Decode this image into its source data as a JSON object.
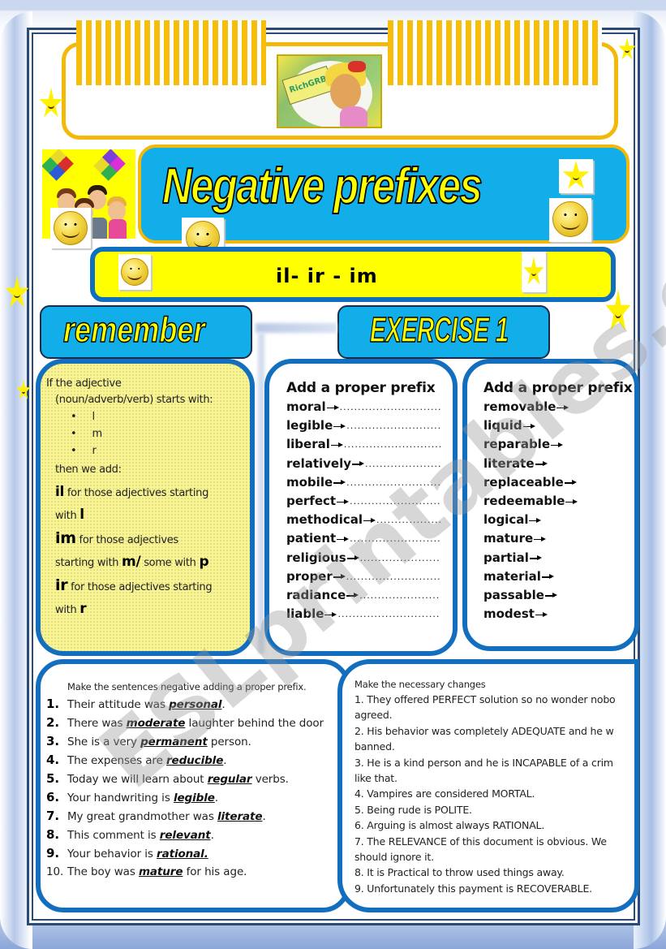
{
  "header": {
    "logo_sign_text": "RichGRB",
    "title": "Negative prefixes",
    "prefixes": "il- ir - im"
  },
  "sections": {
    "remember_label": "remember",
    "exercise_label": "EXERCISE 1"
  },
  "remember": {
    "intro_line1": "If the adjective",
    "intro_line2": "(noun/adverb/verb) starts with:",
    "letters": [
      "l",
      "m",
      "r"
    ],
    "then_line": "then we add:",
    "rules": [
      {
        "prefix": "il",
        "text": " for those adjectives starting",
        "cont": "with ",
        "letter": "l"
      },
      {
        "prefix": "im",
        "text": " for those adjectives",
        "cont": "starting with ",
        "letter": "m/",
        "extra": " some with ",
        "extra_letter": "p"
      },
      {
        "prefix": "ir",
        "text": " for those adjectives starting",
        "cont": "with ",
        "letter": "r"
      }
    ]
  },
  "exercise1": {
    "list_a": {
      "title": "Add a proper prefix",
      "words": [
        "moral",
        "legible",
        "liberal",
        "relatively",
        "mobile",
        "perfect",
        "methodical",
        "patient",
        "religious",
        "proper",
        "radiance",
        "liable"
      ],
      "dots": ".........................................."
    },
    "list_b": {
      "title": "Add a proper prefix",
      "words": [
        "removable",
        "liquid",
        "reparable",
        "literate",
        "replaceable",
        "redeemable",
        "logical",
        "mature",
        "partial",
        "material",
        "passable",
        "modest"
      ]
    }
  },
  "sentences": {
    "intro": "Make the sentences negative adding a proper prefix.",
    "items": [
      {
        "num": "1.",
        "before": "Their attitude was ",
        "word": "personal",
        "after": "."
      },
      {
        "num": "2.",
        "before": "There was ",
        "word": "moderate",
        "after": " laughter behind the door"
      },
      {
        "num": "3.",
        "before": "She is a very ",
        "word": "permanent",
        "after": " person."
      },
      {
        "num": "4.",
        "before": "The expenses are ",
        "word": "reducible",
        "after": "."
      },
      {
        "num": "5.",
        "before": "Today we will learn about ",
        "word": "regular",
        "after": " verbs."
      },
      {
        "num": "6.",
        "before": "Your handwriting is ",
        "word": "legible",
        "after": "."
      },
      {
        "num": "7.",
        "before": "My great grandmother was ",
        "word": "literate",
        "after": "."
      },
      {
        "num": "8.",
        "before": "This comment is ",
        "word": "relevant",
        "after": "."
      },
      {
        "num": "9.",
        "before": "Your behavior is ",
        "word": "rational.",
        "after": ""
      },
      {
        "num": "10.",
        "before": "The boy was ",
        "word": "mature",
        "after": " for his age."
      }
    ]
  },
  "changes": {
    "intro": "Make the necessary changes",
    "lines": [
      "1. They offered PERFECT solution so no wonder nobo",
      "agreed.",
      "2. His behavior was completely ADEQUATE and he w",
      "banned.",
      "3. He is a kind person and he is INCAPABLE of a crim",
      "like that.",
      "4. Vampires are considered MORTAL.",
      "5. Being rude is POLITE.",
      "6. Arguing is almost always RATIONAL.",
      "7. The RELEVANCE of this document is obvious. We",
      "should ignore it.",
      "8. It is Practical to throw used things away.",
      "9. Unfortunately this payment is RECOVERABLE."
    ]
  },
  "watermark": "ESLprintables.com",
  "colors": {
    "accent_blue": "#12aeea",
    "border_blue": "#136fbe",
    "gold": "#f2b80a",
    "yellow": "#ffff00"
  }
}
